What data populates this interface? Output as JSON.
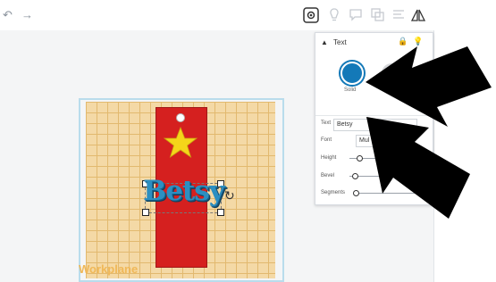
{
  "toolbar": {
    "undo_glyph": "↶",
    "redo_glyph": "→",
    "icons": [
      "eye-icon",
      "lightbulb-icon",
      "speech-bubble-icon",
      "stack-icon",
      "align-icon",
      "mirror-icon"
    ]
  },
  "workplane": {
    "label": "Workplane",
    "grid_color": "#e2b96f",
    "plane_color": "#f4d9a6"
  },
  "scene": {
    "text_object": "Betsy",
    "tag_color": "#d5201f",
    "text_color": "#2c8fc1",
    "star_color": "#f5d51a"
  },
  "inspector": {
    "title": "Text",
    "color_label": "Solid",
    "selected_color": "#1479b8",
    "text_field_label": "Text",
    "text_value": "Betsy",
    "font_label": "Font",
    "font_value": "Mul",
    "height_label": "Height",
    "bevel_label": "Bevel",
    "segments_label": "Segments"
  }
}
